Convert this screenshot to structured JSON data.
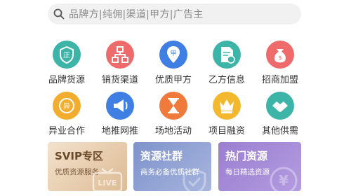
{
  "search": {
    "placeholder": "品牌方|纯佣|渠道|甲方|广告主"
  },
  "categories": [
    {
      "label": "品牌货源",
      "icon": "brand-source-icon",
      "color": "#3cb5a8"
    },
    {
      "label": "销货渠道",
      "icon": "sales-channel-icon",
      "color": "#ef6b6b"
    },
    {
      "label": "优质甲方",
      "icon": "quality-client-icon",
      "color": "#3f7fe3"
    },
    {
      "label": "乙方信息",
      "icon": "vendor-info-icon",
      "color": "#3cb5a8"
    },
    {
      "label": "招商加盟",
      "icon": "franchise-icon",
      "color": "#ef6b6b"
    },
    {
      "label": "异业合作",
      "icon": "cross-industry-icon",
      "color": "#f3ad2e"
    },
    {
      "label": "地推网推",
      "icon": "promotion-icon",
      "color": "#3f7fe3"
    },
    {
      "label": "场地活动",
      "icon": "venue-event-icon",
      "color": "#f07a3c"
    },
    {
      "label": "项目融资",
      "icon": "project-finance-icon",
      "color": "#f3b82e"
    },
    {
      "label": "其他供需",
      "icon": "other-supply-icon",
      "color": "#3cb5a8"
    }
  ],
  "cards": [
    {
      "title": "SVIP专区",
      "subtitle": "优质资源服务",
      "badge": "LIVE",
      "color": "#e9cfb0",
      "text_color": "#6b4a2a"
    },
    {
      "title": "资源社群",
      "subtitle": "商务必备优质社群",
      "color": "#8c9fd0",
      "text_color": "#ffffff"
    },
    {
      "title": "热门资源",
      "subtitle": "每日精选资源",
      "badge": "¥",
      "color": "#a48ad4",
      "text_color": "#ffffff"
    }
  ]
}
